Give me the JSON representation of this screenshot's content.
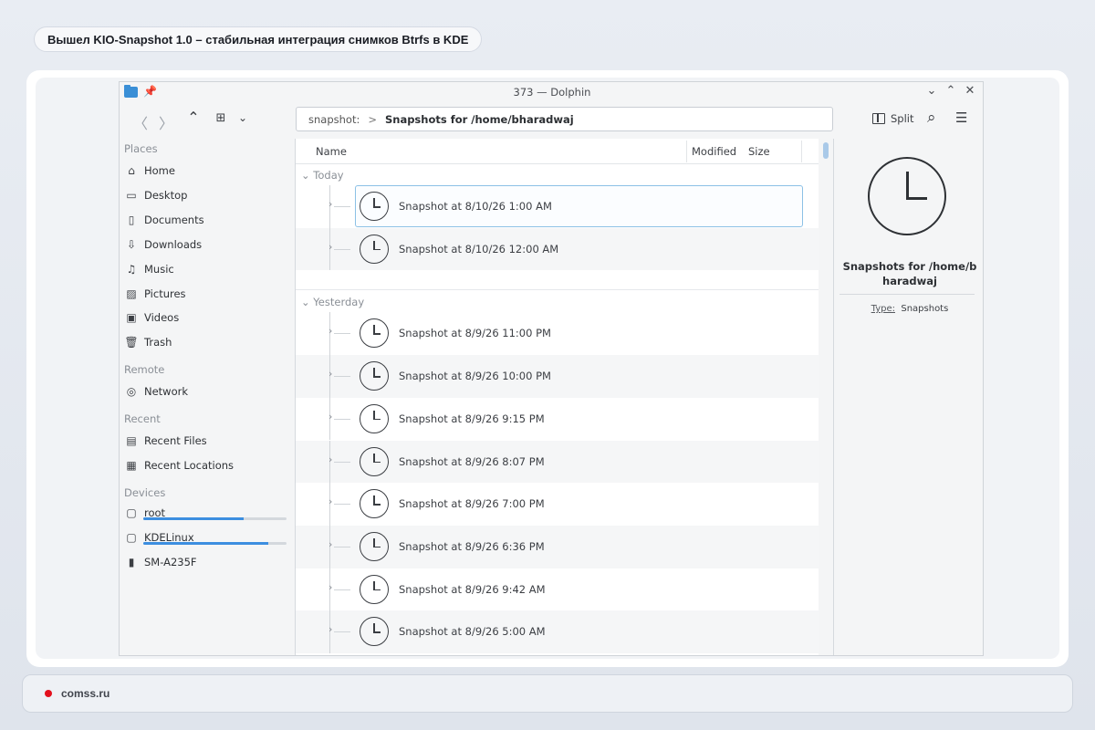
{
  "headline": "Вышел KIO-Snapshot 1.0 – стабильная интеграция снимков Btrfs в KDE",
  "window": {
    "title": "373 — Dolphin"
  },
  "toolbar": {
    "location": {
      "protocol": "snapshot:",
      "current": "Snapshots for /home/bharadwaj"
    },
    "split_label": "Split"
  },
  "sidebar": {
    "places_label": "Places",
    "places": [
      {
        "label": "Home",
        "icon": "home-icon"
      },
      {
        "label": "Desktop",
        "icon": "desktop-icon"
      },
      {
        "label": "Documents",
        "icon": "documents-icon"
      },
      {
        "label": "Downloads",
        "icon": "downloads-icon"
      },
      {
        "label": "Music",
        "icon": "music-icon"
      },
      {
        "label": "Pictures",
        "icon": "pictures-icon"
      },
      {
        "label": "Videos",
        "icon": "videos-icon"
      },
      {
        "label": "Trash",
        "icon": "trash-icon"
      }
    ],
    "remote_label": "Remote",
    "remote": [
      {
        "label": "Network",
        "icon": "network-icon"
      }
    ],
    "recent_label": "Recent",
    "recent": [
      {
        "label": "Recent Files",
        "icon": "recent-files-icon"
      },
      {
        "label": "Recent Locations",
        "icon": "recent-locations-icon"
      }
    ],
    "devices_label": "Devices",
    "devices": [
      {
        "label": "root",
        "icon": "drive-icon",
        "usage": 0.7
      },
      {
        "label": "KDELinux",
        "icon": "drive-icon",
        "usage": 0.87
      },
      {
        "label": "SM-A235F",
        "icon": "phone-icon"
      }
    ]
  },
  "columns": {
    "name": "Name",
    "modified": "Modified",
    "size": "Size"
  },
  "groups": [
    {
      "label": "Today",
      "items": [
        "Snapshot at 8/10/26 1:00 AM",
        "Snapshot at 8/10/26 12:00 AM"
      ]
    },
    {
      "label": "Yesterday",
      "items": [
        "Snapshot at 8/9/26 11:00 PM",
        "Snapshot at 8/9/26 10:00 PM",
        "Snapshot at 8/9/26 9:15 PM",
        "Snapshot at 8/9/26 8:07 PM",
        "Snapshot at 8/9/26 7:00 PM",
        "Snapshot at 8/9/26 6:36 PM",
        "Snapshot at 8/9/26 9:42 AM",
        "Snapshot at 8/9/26 5:00 AM"
      ]
    }
  ],
  "info_panel": {
    "title": "Snapshots for /home/bharadwaj",
    "type_key": "Type:",
    "type_value": "Snapshots"
  },
  "footer": {
    "site": "comss.ru"
  },
  "colors": {
    "accent": "#3c8ee0",
    "brand_dot": "#e3101d"
  }
}
